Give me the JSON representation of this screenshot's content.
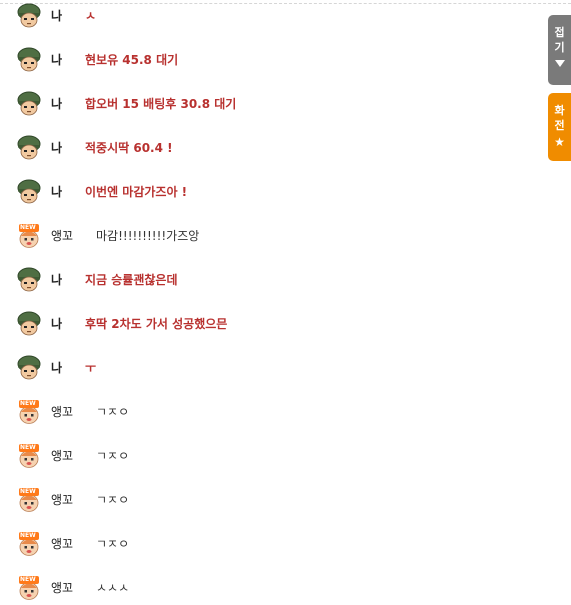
{
  "side_buttons": {
    "fold": {
      "char1": "접",
      "char2": "기"
    },
    "switch": {
      "char1": "화",
      "char2": "전",
      "star": "★"
    }
  },
  "messages": [
    {
      "type": "me",
      "avatar": "soldier-helmet-avatar",
      "nick": "나",
      "text": "ㅅ"
    },
    {
      "type": "me",
      "avatar": "soldier-helmet-avatar",
      "nick": "나",
      "text": "현보유 45.8 대기"
    },
    {
      "type": "me",
      "avatar": "soldier-helmet-avatar",
      "nick": "나",
      "text": "합오버 15 배팅후 30.8 대기"
    },
    {
      "type": "me",
      "avatar": "soldier-helmet-avatar",
      "nick": "나",
      "text": "적중시딱 60.4 !"
    },
    {
      "type": "me",
      "avatar": "soldier-helmet-avatar",
      "nick": "나",
      "text": "이번엔 마감가즈아 !"
    },
    {
      "type": "other",
      "avatar": "new-user-avatar",
      "badge": "NEW",
      "nick": "앵꼬",
      "text": "마감!!!!!!!!!!가즈앙"
    },
    {
      "type": "me",
      "avatar": "soldier-helmet-avatar",
      "nick": "나",
      "text": "지금 승률괜찮은데"
    },
    {
      "type": "me",
      "avatar": "soldier-helmet-avatar",
      "nick": "나",
      "text": "후딱 2차도 가서 성공했으믄"
    },
    {
      "type": "me",
      "avatar": "soldier-helmet-avatar",
      "nick": "나",
      "text": "ㅜ"
    },
    {
      "type": "other",
      "avatar": "new-user-avatar",
      "badge": "NEW",
      "nick": "앵꼬",
      "text": "ㄱㅈㅇ"
    },
    {
      "type": "other",
      "avatar": "new-user-avatar",
      "badge": "NEW",
      "nick": "앵꼬",
      "text": "ㄱㅈㅇ"
    },
    {
      "type": "other",
      "avatar": "new-user-avatar",
      "badge": "NEW",
      "nick": "앵꼬",
      "text": "ㄱㅈㅇ"
    },
    {
      "type": "other",
      "avatar": "new-user-avatar",
      "badge": "NEW",
      "nick": "앵꼬",
      "text": "ㄱㅈㅇ"
    },
    {
      "type": "other",
      "avatar": "new-user-avatar",
      "badge": "NEW",
      "nick": "앵꼬",
      "text": "ㅅㅅㅅ"
    }
  ]
}
